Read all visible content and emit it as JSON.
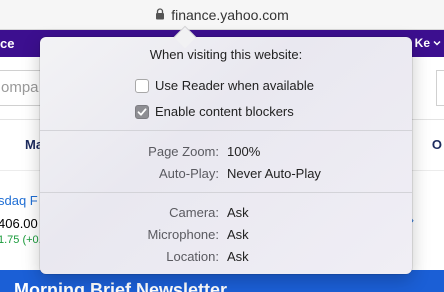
{
  "browser": {
    "url": "finance.yahoo.com"
  },
  "background_page": {
    "nav_left": "ce",
    "nav_right": "Ke",
    "search_placeholder": "ompa",
    "menu_left": "Ma",
    "menu_right": "O",
    "ticker_name": "sdaq F",
    "ticker_price": "406.00",
    "ticker_change": "1.75 (+0.",
    "banner_text": "Morning Brief Newsletter"
  },
  "popover": {
    "title": "When visiting this website:",
    "reader_label": "Use Reader when available",
    "reader_checked": false,
    "blockers_label": "Enable content blockers",
    "blockers_checked": true,
    "page_zoom_label": "Page Zoom:",
    "page_zoom_value": "100%",
    "autoplay_label": "Auto-Play:",
    "autoplay_value": "Never Auto-Play",
    "camera_label": "Camera:",
    "camera_value": "Ask",
    "microphone_label": "Microphone:",
    "microphone_value": "Ask",
    "location_label": "Location:",
    "location_value": "Ask"
  },
  "colors": {
    "yahoo_purple": "#3c0f8f",
    "banner_blue": "#1b5fd6",
    "positive_green": "#1a9b3b"
  }
}
